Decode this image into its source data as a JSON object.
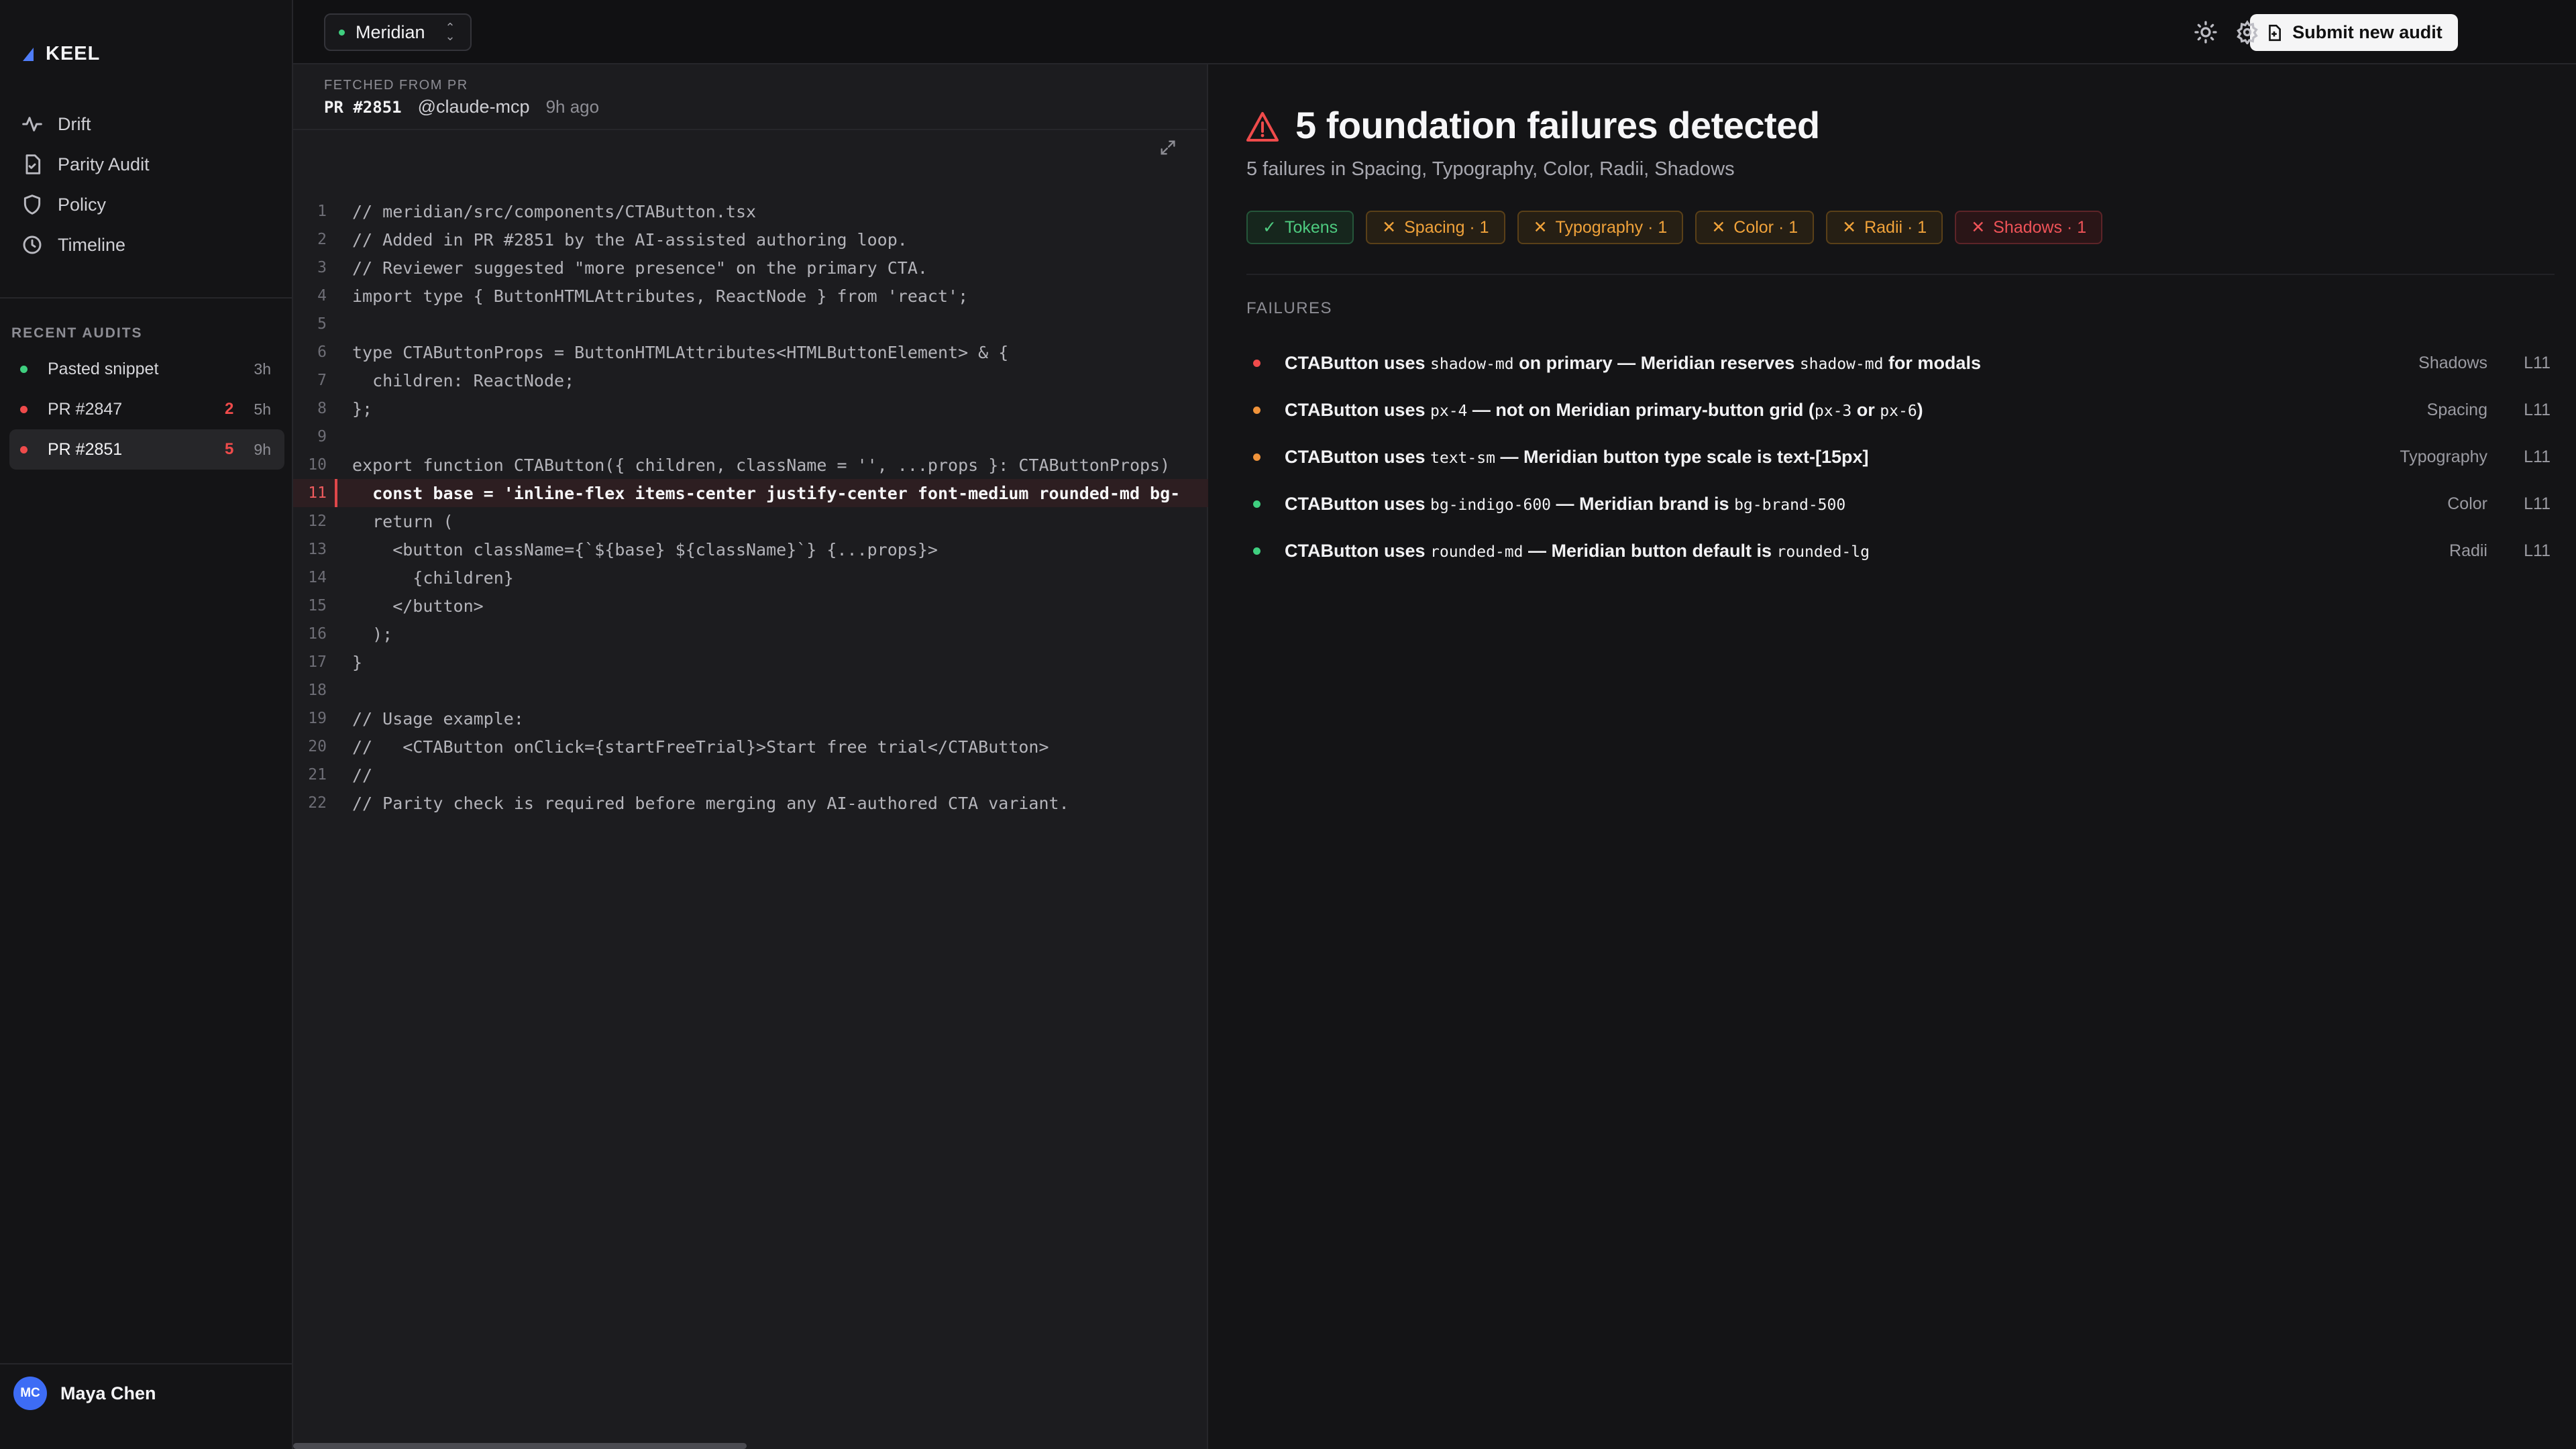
{
  "app": {
    "name": "KEEL"
  },
  "nav": [
    {
      "label": "Drift",
      "icon": "activity-icon"
    },
    {
      "label": "Parity Audit",
      "icon": "file-check-icon"
    },
    {
      "label": "Policy",
      "icon": "shield-icon"
    },
    {
      "label": "Timeline",
      "icon": "clock-icon"
    }
  ],
  "recent": {
    "title": "RECENT AUDITS",
    "items": [
      {
        "name": "Pasted snippet",
        "count": "",
        "age": "3h",
        "status": "pass"
      },
      {
        "name": "PR #2847",
        "count": "2",
        "age": "5h",
        "status": "fail"
      },
      {
        "name": "PR #2851",
        "count": "5",
        "age": "9h",
        "status": "fail"
      }
    ]
  },
  "user": {
    "initials": "MC",
    "name": "Maya Chen"
  },
  "topbar": {
    "project": "Meridian",
    "submit_label": "Submit new audit"
  },
  "source": {
    "fetched_label": "FETCHED FROM PR",
    "pr": "PR #2851",
    "author": "@claude-mcp",
    "time": "9h ago",
    "highlight_line": 11,
    "lines": [
      "// meridian/src/components/CTAButton.tsx",
      "// Added in PR #2851 by the AI-assisted authoring loop.",
      "// Reviewer suggested \"more presence\" on the primary CTA.",
      "import type { ButtonHTMLAttributes, ReactNode } from 'react';",
      "",
      "type CTAButtonProps = ButtonHTMLAttributes<HTMLButtonElement> & {",
      "  children: ReactNode;",
      "};",
      "",
      "export function CTAButton({ children, className = '', ...props }: CTAButtonProps)",
      "  const base = 'inline-flex items-center justify-center font-medium rounded-md bg-",
      "  return (",
      "    <button className={`${base} ${className}`} {...props}>",
      "      {children}",
      "    </button>",
      "  );",
      "}",
      "",
      "// Usage example:",
      "//   <CTAButton onClick={startFreeTrial}>Start free trial</CTAButton>",
      "//",
      "// Parity check is required before merging any AI-authored CTA variant."
    ]
  },
  "summary": {
    "title": "5 foundation failures detected",
    "subtitle": "5 failures in Spacing, Typography, Color, Radii, Shadows"
  },
  "chips": [
    {
      "label": "Tokens",
      "kind": "ok"
    },
    {
      "label": "Spacing · 1",
      "kind": "warn"
    },
    {
      "label": "Typography · 1",
      "kind": "warn"
    },
    {
      "label": "Color · 1",
      "kind": "warn"
    },
    {
      "label": "Radii · 1",
      "kind": "warn"
    },
    {
      "label": "Shadows · 1",
      "kind": "err"
    }
  ],
  "failures": {
    "title": "FAILURES",
    "items": [
      {
        "severity": "error",
        "parts": [
          "CTAButton uses ",
          "shadow-md",
          " on primary — Meridian reserves ",
          "shadow-md",
          " for modals"
        ],
        "category": "Shadows",
        "line": "L11"
      },
      {
        "severity": "warning",
        "parts": [
          "CTAButton uses ",
          "px-4",
          " — not on Meridian primary-button grid (",
          "px-3",
          " or ",
          "px-6",
          ")"
        ],
        "category": "Spacing",
        "line": "L11"
      },
      {
        "severity": "warning",
        "parts": [
          "CTAButton uses ",
          "text-sm",
          " — Meridian button type scale is text-[15px]"
        ],
        "category": "Typography",
        "line": "L11"
      },
      {
        "severity": "info",
        "parts": [
          "CTAButton uses ",
          "bg-indigo-600",
          " — Meridian brand is ",
          "bg-brand-500"
        ],
        "category": "Color",
        "line": "L11"
      },
      {
        "severity": "info",
        "parts": [
          "CTAButton uses ",
          "rounded-md",
          " — Meridian button default is ",
          "rounded-lg"
        ],
        "category": "Radii",
        "line": "L11"
      }
    ]
  },
  "colors": {
    "accent": "#4f7df9",
    "error": "#ef4b4b",
    "warning": "#f0933a",
    "success": "#3fcf7f"
  }
}
